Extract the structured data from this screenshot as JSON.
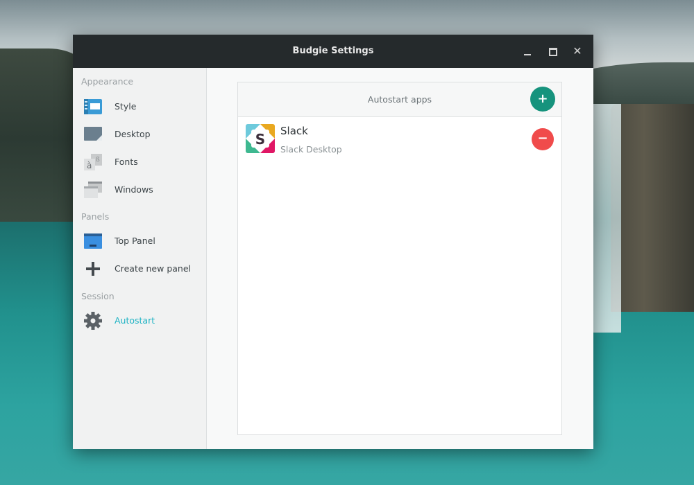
{
  "window": {
    "title": "Budgie Settings",
    "controls": [
      "minimize-icon",
      "maximize-icon",
      "close-icon"
    ],
    "close_glyph": "✕"
  },
  "sidebar": {
    "sections": [
      {
        "label": "Appearance",
        "items": [
          {
            "label": "Style",
            "icon": "style-icon",
            "active": false
          },
          {
            "label": "Desktop",
            "icon": "desktop-icon",
            "active": false
          },
          {
            "label": "Fonts",
            "icon": "fonts-icon",
            "active": false
          },
          {
            "label": "Windows",
            "icon": "windows-icon",
            "active": false
          }
        ]
      },
      {
        "label": "Panels",
        "items": [
          {
            "label": "Top Panel",
            "icon": "panel-icon",
            "active": false
          },
          {
            "label": "Create new panel",
            "icon": "plus-icon",
            "active": false
          }
        ]
      },
      {
        "label": "Session",
        "items": [
          {
            "label": "Autostart",
            "icon": "gear-icon",
            "active": true
          }
        ]
      }
    ]
  },
  "autostart": {
    "header": "Autostart apps",
    "add_glyph": "+",
    "remove_glyph": "−",
    "apps": [
      {
        "name": "Slack",
        "description": "Slack Desktop",
        "icon": "slack-icon"
      }
    ]
  },
  "colors": {
    "accent": "#1fb3c4",
    "add_button": "#16937d",
    "remove_button": "#f04b4b",
    "titlebar": "#252a2c"
  }
}
